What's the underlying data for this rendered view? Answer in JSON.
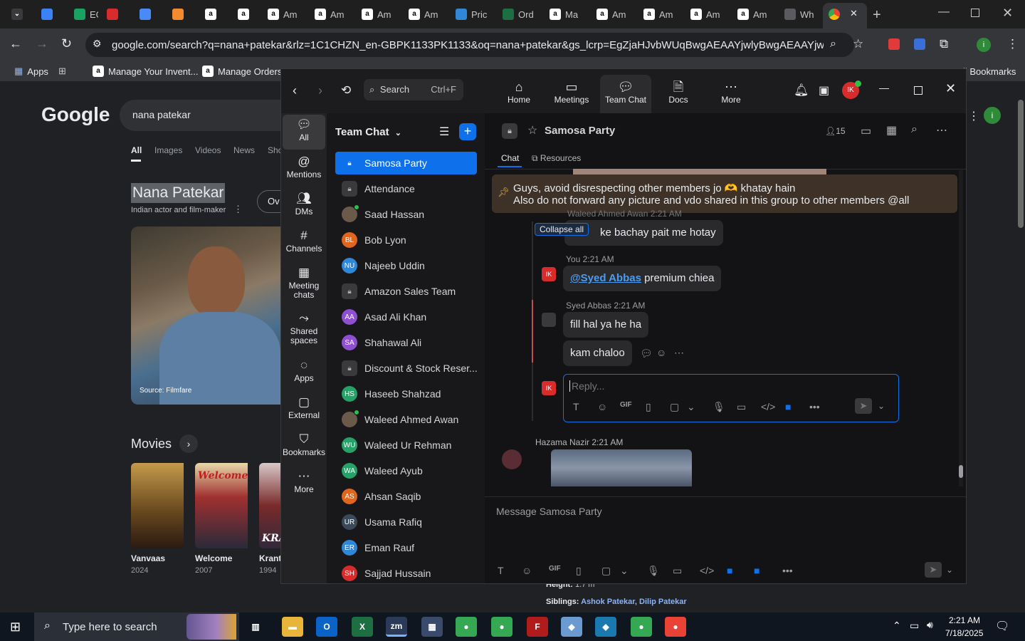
{
  "browser": {
    "tabs": [
      {
        "label": "",
        "icon": "expand-tabs-icon"
      },
      {
        "label": "",
        "icon": "app-icon"
      },
      {
        "label": "EG",
        "icon": "eg-icon"
      },
      {
        "label": "",
        "icon": "app-red-icon"
      },
      {
        "label": "",
        "icon": "app-blue-icon"
      },
      {
        "label": "",
        "icon": "app-orange-icon"
      },
      {
        "label": "",
        "icon": "amazon-icon"
      },
      {
        "label": "",
        "icon": "amazon-icon"
      },
      {
        "label": "Am",
        "icon": "amazon-icon"
      },
      {
        "label": "Am",
        "icon": "amazon-icon"
      },
      {
        "label": "Am",
        "icon": "amazon-icon"
      },
      {
        "label": "Am",
        "icon": "amazon-icon"
      },
      {
        "label": "Pric",
        "icon": "dollar-icon"
      },
      {
        "label": "Ord",
        "icon": "excel-icon"
      },
      {
        "label": "Ma",
        "icon": "amazon-icon"
      },
      {
        "label": "Am",
        "icon": "amazon-icon"
      },
      {
        "label": "Am",
        "icon": "amazon-icon"
      },
      {
        "label": "Am",
        "icon": "amazon-icon"
      },
      {
        "label": "Am",
        "icon": "amazon-icon"
      },
      {
        "label": "Wh",
        "icon": "chatgpt-icon"
      }
    ],
    "url": "google.com/search?q=nana+patekar&rlz=1C1CHZN_en-GBPK1133PK1133&oq=nana+patekar&gs_lcrp=EgZjaHJvbWUqBwgAEAAYjwlyBwgAEAAYjwlyCggBEC4...",
    "bookmarks": {
      "apps": "Apps",
      "manage_inventory": "Manage Your Invent...",
      "manage_orders": "Manage Orders",
      "all_bookmarks": "All Bookmarks"
    }
  },
  "google": {
    "logo": "Google",
    "query": "nana patekar",
    "tabs": [
      "All",
      "Images",
      "Videos",
      "News",
      "Sho"
    ],
    "entity_name": "Nana Patekar",
    "entity_desc": "Indian actor and film-maker",
    "overview": "Ov",
    "source": "Source: Filmfare",
    "movies_heading": "Movies",
    "movies": [
      {
        "title": "Vanvaas",
        "year": "2024",
        "poster_text": ""
      },
      {
        "title": "Welcome",
        "year": "2007",
        "poster_text": "Welcome"
      },
      {
        "title": "Kranti",
        "year": "1994",
        "poster_text": "KRA"
      }
    ],
    "height_label": "Height:",
    "height_value": "1.7 m",
    "siblings_label": "Siblings:",
    "siblings_value": "Ashok Patekar, Dilip Patekar"
  },
  "zoom": {
    "search_label": "Search",
    "search_shortcut": "Ctrl+F",
    "nav": [
      {
        "label": "Home",
        "icon": "home-icon"
      },
      {
        "label": "Meetings",
        "icon": "video-icon"
      },
      {
        "label": "Team Chat",
        "icon": "chat-icon"
      },
      {
        "label": "Docs",
        "icon": "docs-icon"
      },
      {
        "label": "More",
        "icon": "more-icon"
      }
    ],
    "user_initials": "IK",
    "rail": [
      {
        "label": "All",
        "icon": "chat-bubble-icon"
      },
      {
        "label": "Mentions",
        "icon": "at-icon"
      },
      {
        "label": "DMs",
        "icon": "people-icon"
      },
      {
        "label": "Channels",
        "icon": "hash-icon"
      },
      {
        "label": "Meeting chats",
        "icon": "calendar-icon"
      },
      {
        "label": "Shared spaces",
        "icon": "share-icon"
      },
      {
        "label": "Apps",
        "icon": "apps-icon"
      },
      {
        "label": "External",
        "icon": "external-icon"
      },
      {
        "label": "Bookmarks",
        "icon": "bookmark-icon"
      },
      {
        "label": "More",
        "icon": "more-icon"
      }
    ],
    "chat_header": "Team Chat",
    "channels": [
      {
        "name": "Samosa Party",
        "initials": "",
        "type": "lock",
        "color": "#0e71eb",
        "online": false,
        "active": true
      },
      {
        "name": "Attendance",
        "initials": "",
        "type": "lock",
        "color": "#3a3a3d",
        "online": false,
        "active": false
      },
      {
        "name": "Saad Hassan",
        "initials": "",
        "type": "photo",
        "color": "#6b5a4a",
        "online": true,
        "active": false
      },
      {
        "name": "Bob Lyon",
        "initials": "BL",
        "type": "initials",
        "color": "#e0661f",
        "online": true,
        "active": false
      },
      {
        "name": "Najeeb Uddin",
        "initials": "NU",
        "type": "initials",
        "color": "#2f87d6",
        "online": true,
        "active": false
      },
      {
        "name": "Amazon Sales Team",
        "initials": "",
        "type": "lock",
        "color": "#3a3a3d",
        "online": false,
        "active": false
      },
      {
        "name": "Asad Ali Khan",
        "initials": "AA",
        "type": "initials",
        "color": "#8e4fd1",
        "online": true,
        "active": false
      },
      {
        "name": "Shahawal Ali",
        "initials": "SA",
        "type": "initials",
        "color": "#8e4fd1",
        "online": true,
        "active": false
      },
      {
        "name": "Discount & Stock Reser...",
        "initials": "",
        "type": "lock",
        "color": "#3a3a3d",
        "online": false,
        "active": false
      },
      {
        "name": "Haseeb Shahzad",
        "initials": "HS",
        "type": "initials",
        "color": "#26a269",
        "online": true,
        "active": false
      },
      {
        "name": "Waleed Ahmed Awan",
        "initials": "",
        "type": "photo",
        "color": "#6b5a4a",
        "online": true,
        "active": false
      },
      {
        "name": "Waleed Ur Rehman",
        "initials": "WU",
        "type": "initials",
        "color": "#26a269",
        "online": true,
        "active": false
      },
      {
        "name": "Waleed Ayub",
        "initials": "WA",
        "type": "initials",
        "color": "#26a269",
        "online": true,
        "active": false
      },
      {
        "name": "Ahsan Saqib",
        "initials": "AS",
        "type": "initials",
        "color": "#e0661f",
        "online": true,
        "active": false
      },
      {
        "name": "Usama Rafiq",
        "initials": "UR",
        "type": "initials",
        "color": "#3a4a5a",
        "online": false,
        "active": false
      },
      {
        "name": "Eman Rauf",
        "initials": "ER",
        "type": "initials",
        "color": "#2f87d6",
        "online": true,
        "active": false
      },
      {
        "name": "Sajjad Hussain",
        "initials": "SH",
        "type": "initials",
        "color": "#d82c2c",
        "online": true,
        "active": false
      }
    ],
    "channel_title": "Samosa Party",
    "member_count": "15",
    "pane_tabs": [
      "Chat",
      "Resources"
    ],
    "pinned_line1": "Guys, avoid disrespecting other members jo 🫶 khatay hain",
    "pinned_line2": "Also do not forward any picture and vdo shared in this group to other members @all",
    "collapse_all": "Collapse all",
    "partial_sender": "Waleed Ahmed Awan 2:21 AM",
    "partial_msg": "ke bachay pait me hotay",
    "msg_you_meta": "You 2:21 AM",
    "msg_you_mention": "@Syed Abbas",
    "msg_you_text": " premium chiea",
    "msg_syed_meta": "Syed Abbas 2:21 AM",
    "msg_syed_1": "fill hal ya he ha",
    "msg_syed_2": "kam chaloo",
    "reply_placeholder": "Reply...",
    "hazama_meta": "Hazama Nazir 2:21 AM",
    "compose_placeholder": "Message Samosa Party"
  },
  "taskbar": {
    "search_placeholder": "Type here to search",
    "time": "2:21 AM",
    "date": "7/18/2025"
  }
}
